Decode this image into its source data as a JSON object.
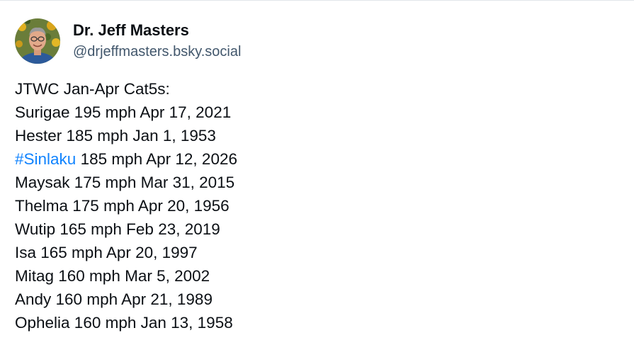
{
  "author": {
    "display_name": "Dr. Jeff Masters",
    "handle": "@drjeffmasters.bsky.social",
    "avatar_icon": "profile-photo"
  },
  "post": {
    "intro": "JTWC Jan-Apr Cat5s:",
    "entries": [
      {
        "name": "Surigae",
        "rest": "Surigae 195 mph Apr 17, 2021"
      },
      {
        "name": "Hester",
        "rest": "Hester 185 mph Jan 1, 1953"
      },
      {
        "hashtag": "#Sinlaku",
        "rest": " 185 mph Apr 12, 2026"
      },
      {
        "name": "Maysak",
        "rest": "Maysak 175 mph Mar 31, 2015"
      },
      {
        "name": "Thelma",
        "rest": "Thelma 175 mph Apr 20, 1956"
      },
      {
        "name": "Wutip",
        "rest": "Wutip 165 mph Feb 23, 2019"
      },
      {
        "name": "Isa",
        "rest": "Isa 165 mph Apr 20, 1997"
      },
      {
        "name": "Mitag",
        "rest": "Mitag 160 mph Mar 5, 2002"
      },
      {
        "name": "Andy",
        "rest": "Andy 160 mph Apr 21, 1989"
      },
      {
        "name": "Ophelia",
        "rest": "Ophelia 160 mph Jan 13, 1958"
      }
    ]
  },
  "colors": {
    "text": "#0b0f14",
    "handle": "#42576c",
    "link": "#1083fe",
    "divider": "#e2e6ea"
  }
}
